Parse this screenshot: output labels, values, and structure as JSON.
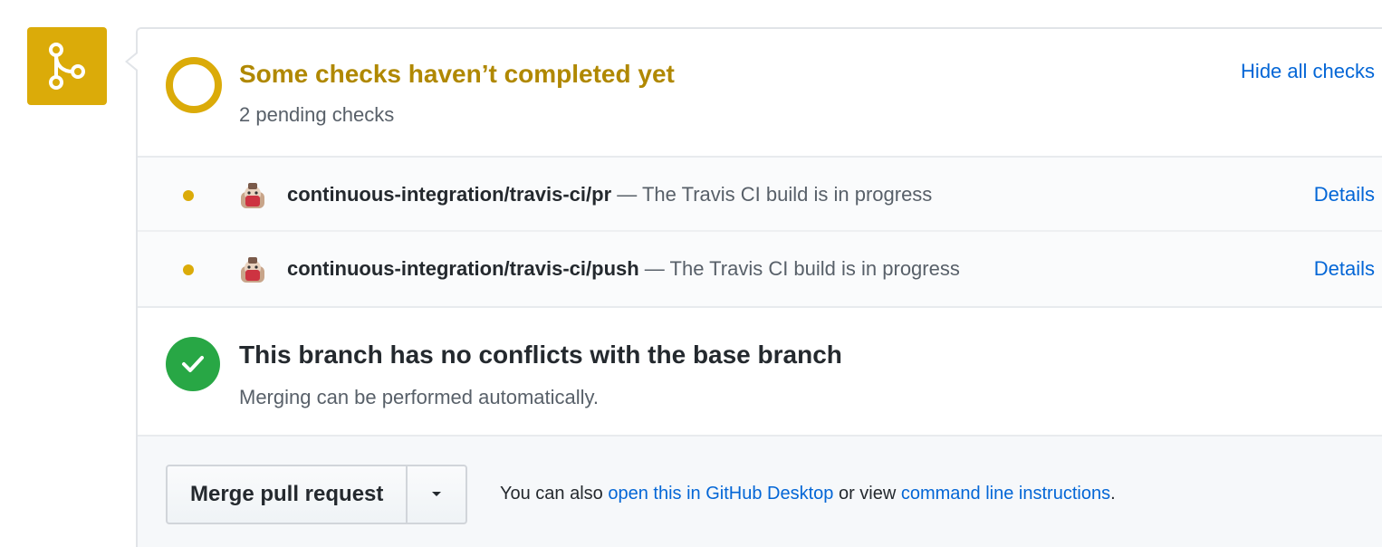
{
  "colors": {
    "pending": "#dbab09",
    "pending_text": "#b08800",
    "success": "#28a745",
    "link": "#0366d6",
    "text": "#24292e",
    "muted": "#586069"
  },
  "badge": {
    "icon": "git-merge-icon"
  },
  "checks": {
    "title": "Some checks haven’t completed yet",
    "subtitle": "2 pending checks",
    "toggle_label": "Hide all checks",
    "items": [
      {
        "name": "continuous-integration/travis-ci/pr",
        "description": " — The Travis CI build is in progress",
        "details_label": "Details",
        "status": "pending",
        "avatar_icon": "travis-ci-icon"
      },
      {
        "name": "continuous-integration/travis-ci/push",
        "description": " — The Travis CI build is in progress",
        "details_label": "Details",
        "status": "pending",
        "avatar_icon": "travis-ci-icon"
      }
    ]
  },
  "branch": {
    "title": "This branch has no conflicts with the base branch",
    "subtitle": "Merging can be performed automatically.",
    "icon": "check-icon"
  },
  "merge": {
    "button_label": "Merge pull request",
    "dropdown_icon": "caret-down-icon",
    "help_prefix": "You can also ",
    "help_link1": "open this in GitHub Desktop",
    "help_middle": " or view ",
    "help_link2": "command line instructions",
    "help_suffix": "."
  }
}
